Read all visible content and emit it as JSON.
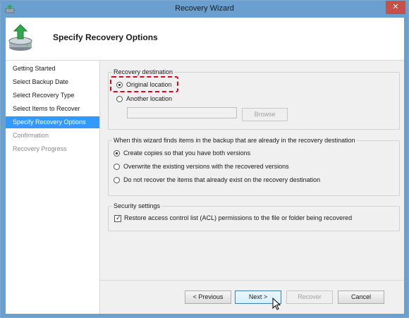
{
  "window": {
    "title": "Recovery Wizard"
  },
  "header": {
    "title": "Specify Recovery Options"
  },
  "sidebar": {
    "items": [
      {
        "label": "Getting Started",
        "state": "normal"
      },
      {
        "label": "Select Backup Date",
        "state": "normal"
      },
      {
        "label": "Select Recovery Type",
        "state": "normal"
      },
      {
        "label": "Select Items to Recover",
        "state": "normal"
      },
      {
        "label": "Specify Recovery Options",
        "state": "active"
      },
      {
        "label": "Confirmation",
        "state": "disabled"
      },
      {
        "label": "Recovery Progress",
        "state": "disabled"
      }
    ]
  },
  "destination": {
    "label": "Recovery destination",
    "original": "Original location",
    "another": "Another location",
    "selected": "original",
    "path_value": "",
    "browse": "Browse"
  },
  "conflicts": {
    "label": "When this wizard finds items in the backup that are already in the recovery destination",
    "options": [
      "Create copies so that you have both versions",
      "Overwrite the existing versions with the recovered versions",
      "Do not recover the items that already exist on the recovery destination"
    ],
    "selected_index": 0
  },
  "security": {
    "label": "Security settings",
    "acl": "Restore access control list (ACL) permissions to the file or folder being recovered",
    "acl_checked": true
  },
  "buttons": {
    "previous": "< Previous",
    "next": "Next >",
    "recover": "Recover",
    "cancel": "Cancel"
  },
  "colors": {
    "titlebar": "#6aa0d0",
    "active_nav": "#3399ff",
    "highlight": "#e3001b",
    "close": "#c7504a"
  },
  "icons": {
    "app": "backup-disk-icon",
    "header": "backup-disk-arrow-icon",
    "close": "close-icon",
    "cursor": "mouse-pointer-icon"
  }
}
